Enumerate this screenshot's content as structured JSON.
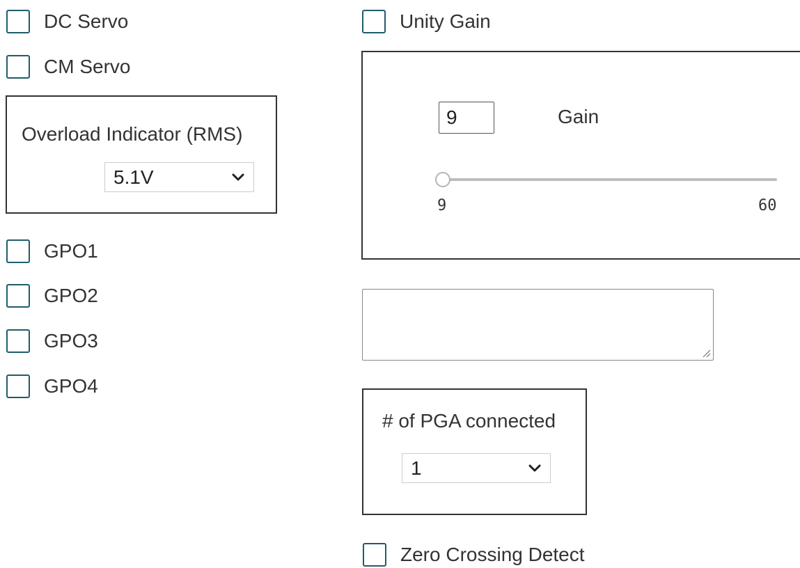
{
  "left_column": {
    "checkboxes_top": [
      {
        "label": "DC Servo",
        "checked": false
      },
      {
        "label": "CM Servo",
        "checked": false
      }
    ],
    "overload_panel": {
      "title": "Overload Indicator (RMS)",
      "selected": "5.1V"
    },
    "gpo_checkboxes": [
      {
        "label": "GPO1",
        "checked": false
      },
      {
        "label": "GPO2",
        "checked": false
      },
      {
        "label": "GPO3",
        "checked": false
      },
      {
        "label": "GPO4",
        "checked": false
      }
    ]
  },
  "right_column": {
    "unity_gain": {
      "label": "Unity Gain",
      "checked": false
    },
    "gain_panel": {
      "input_value": "9",
      "label": "Gain",
      "slider": {
        "min": "9",
        "max": "60",
        "value": 9
      }
    },
    "textarea": {
      "value": ""
    },
    "pga_panel": {
      "title": "# of PGA connected",
      "selected": "1"
    },
    "zero_crossing": {
      "label": "Zero Crossing Detect",
      "checked": false
    }
  },
  "icons": {
    "dropdown": "chevron-down-icon",
    "textarea_resize": "resize-grip-icon"
  },
  "colors": {
    "checkbox_border": "#1f5c6b",
    "panel_border": "#333333",
    "slider_track": "#bdbdbd"
  }
}
